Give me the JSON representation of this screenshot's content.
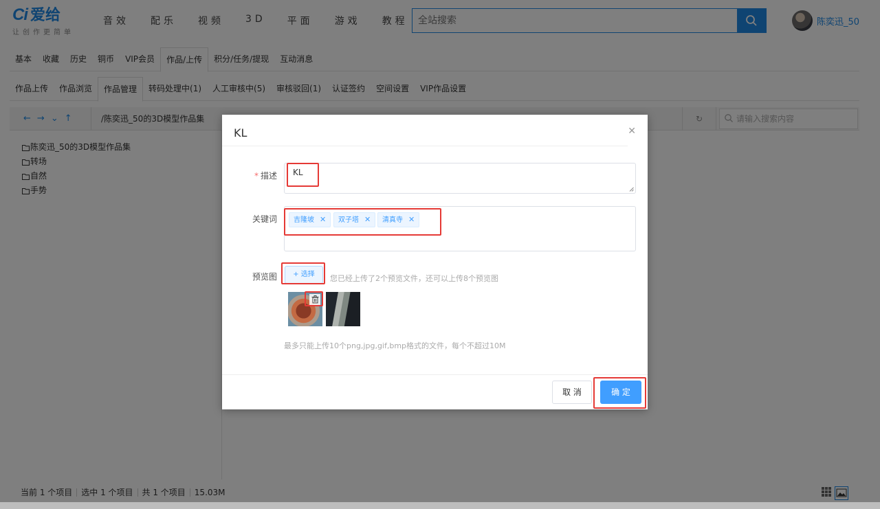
{
  "header": {
    "logo_mark": "Ci",
    "logo_text": "爱给",
    "slogan": "让创作更简单",
    "nav": [
      "音效",
      "配乐",
      "视频",
      "3D",
      "平面",
      "游戏",
      "教程"
    ],
    "search_placeholder": "全站搜索",
    "username": "陈奕迅_50"
  },
  "tabs_primary": {
    "items": [
      "基本",
      "收藏",
      "历史",
      "铜币",
      "VIP会员",
      "作品/上传",
      "积分/任务/提现",
      "互动消息"
    ],
    "active": "作品/上传"
  },
  "tabs_secondary": {
    "items": [
      "作品上传",
      "作品浏览",
      "作品管理",
      "转码处理中(1)",
      "人工审核中(5)",
      "审核驳回(1)",
      "认证签约",
      "空间设置",
      "VIP作品设置"
    ],
    "active": "作品管理"
  },
  "file_manager": {
    "path": "/陈奕迅_50的3D模型作品集",
    "search_placeholder": "请输入搜索内容",
    "tree": [
      "陈奕迅_50的3D模型作品集",
      "转场",
      "自然",
      "手势"
    ],
    "status": {
      "current": "当前 1 个项目",
      "selected": "选中 1 个项目",
      "total": "共 1 个项目",
      "size": "15.03M"
    }
  },
  "dialog": {
    "title": "KL",
    "description_label": "描述",
    "description_value": "KL",
    "keywords_label": "关键词",
    "keywords": [
      "吉隆坡",
      "双子塔",
      "清真寺"
    ],
    "preview_label": "预览图",
    "choose_button": "+ 选择",
    "upload_tip": "您已经上传了2个预览文件，还可以上传8个预览图",
    "limit_tip": "最多只能上传10个png,jpg,gif,bmp格式的文件，每个不超过10M",
    "cancel_button": "取 消",
    "ok_button": "确 定"
  },
  "colors": {
    "brand": "#1e88e5",
    "primary_button": "#409eff",
    "highlight": "#e53935"
  }
}
